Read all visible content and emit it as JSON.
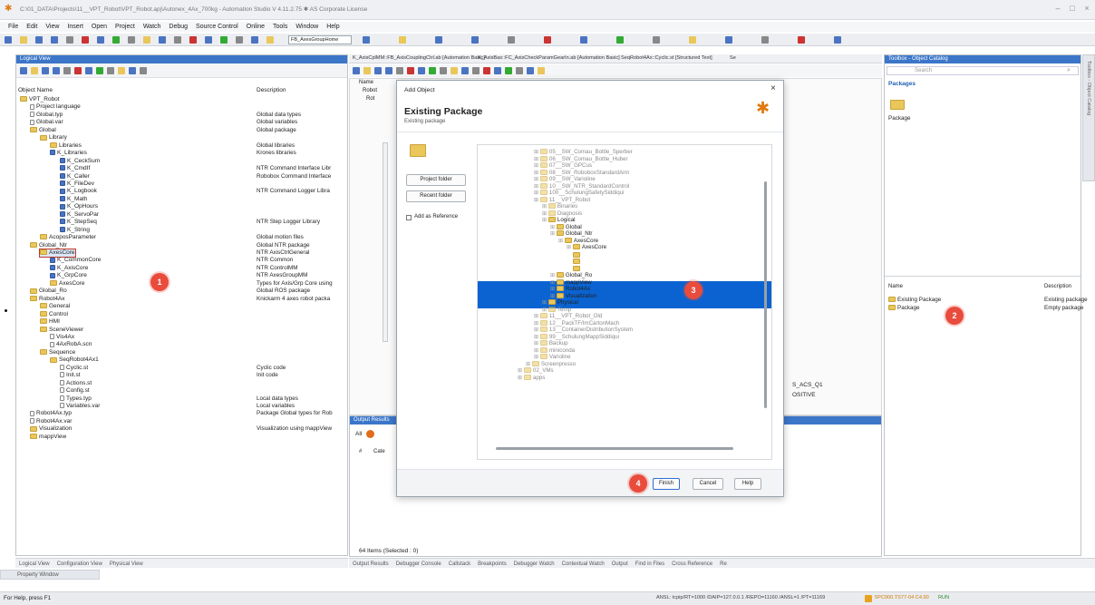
{
  "window": {
    "title": "C:\\01_DATA\\Projects\\11__VPT_Robot\\VPT_Robot.apj\\Autonex_4Ax_700kg - Automation Studio V 4.11.2.75 ✱ AS Corporate License"
  },
  "menu": [
    "File",
    "Edit",
    "View",
    "Insert",
    "Open",
    "Project",
    "Watch",
    "Debug",
    "Source Control",
    "Online",
    "Tools",
    "Window",
    "Help"
  ],
  "toolbar": {
    "combo_value": "FB_AxesGroupHome"
  },
  "logical_view": {
    "header": "Logical View",
    "col_object": "Object Name",
    "col_description": "Description",
    "items": [
      {
        "name": "VPT_Robot",
        "depth": 0,
        "desc": ""
      },
      {
        "name": "Project language",
        "depth": 1,
        "desc": ""
      },
      {
        "name": "Global.typ",
        "depth": 1,
        "desc": "Global data types"
      },
      {
        "name": "Global.var",
        "depth": 1,
        "desc": "Global variables"
      },
      {
        "name": "Global",
        "depth": 1,
        "desc": "Global package"
      },
      {
        "name": "Library",
        "depth": 2,
        "desc": ""
      },
      {
        "name": "Libraries",
        "depth": 3,
        "desc": "Global libraries"
      },
      {
        "name": "K_Libraries",
        "depth": 3,
        "desc": "Krones libraries"
      },
      {
        "name": "K_CeckSum",
        "depth": 4,
        "desc": ""
      },
      {
        "name": "K_CmdIf",
        "depth": 4,
        "desc": "NTR Command Interface Libr"
      },
      {
        "name": "K_Caller",
        "depth": 4,
        "desc": "Robobox Command Interface"
      },
      {
        "name": "K_FileDev",
        "depth": 4,
        "desc": ""
      },
      {
        "name": "K_Logbook",
        "depth": 4,
        "desc": "NTR Command Logger Libra"
      },
      {
        "name": "K_Math",
        "depth": 4,
        "desc": ""
      },
      {
        "name": "K_OpHours",
        "depth": 4,
        "desc": ""
      },
      {
        "name": "K_ServoPar",
        "depth": 4,
        "desc": ""
      },
      {
        "name": "K_StepSeq",
        "depth": 4,
        "desc": "NTR Step Logger Library"
      },
      {
        "name": "K_String",
        "depth": 4,
        "desc": ""
      },
      {
        "name": "AcoposParameter",
        "depth": 2,
        "desc": "Global motion files"
      },
      {
        "name": "Global_Ntr",
        "depth": 1,
        "desc": "Global NTR package"
      },
      {
        "name": "AxesCore",
        "depth": 2,
        "desc": "NTR AxisCtrlGeneral"
      },
      {
        "name": "K_CommonCore",
        "depth": 3,
        "desc": "NTR Common"
      },
      {
        "name": "K_AxisCore",
        "depth": 3,
        "desc": "NTR ControlMM"
      },
      {
        "name": "K_GrpCore",
        "depth": 3,
        "desc": "NTR AxesGroupMM"
      },
      {
        "name": "AxesCore",
        "depth": 3,
        "desc": "Types for Axis/Grp Core using"
      },
      {
        "name": "Global_Ro",
        "depth": 1,
        "desc": "Global ROS package"
      },
      {
        "name": "Robot4Ax",
        "depth": 1,
        "desc": "Knickarm 4 axes robot packa"
      },
      {
        "name": "General",
        "depth": 2,
        "desc": ""
      },
      {
        "name": "Control",
        "depth": 2,
        "desc": ""
      },
      {
        "name": "HMI",
        "depth": 2,
        "desc": ""
      },
      {
        "name": "SceneViewer",
        "depth": 2,
        "desc": ""
      },
      {
        "name": "Vis4Ax",
        "depth": 3,
        "desc": ""
      },
      {
        "name": "4AxRobA.scn",
        "depth": 3,
        "desc": ""
      },
      {
        "name": "Sequence",
        "depth": 2,
        "desc": ""
      },
      {
        "name": "SeqRobot4Ax1",
        "depth": 3,
        "desc": ""
      },
      {
        "name": "Cyclic.st",
        "depth": 4,
        "desc": "Cyclic code"
      },
      {
        "name": "Init.st",
        "depth": 4,
        "desc": "Init code"
      },
      {
        "name": "Actions.st",
        "depth": 4,
        "desc": ""
      },
      {
        "name": "Config.st",
        "depth": 4,
        "desc": ""
      },
      {
        "name": "Types.typ",
        "depth": 4,
        "desc": "Local data types"
      },
      {
        "name": "Variables.var",
        "depth": 4,
        "desc": "Local variables"
      },
      {
        "name": "Robot4Ax.typ",
        "depth": 1,
        "desc": "Package Global types for Rob"
      },
      {
        "name": "Robot4Ax.var",
        "depth": 1,
        "desc": ""
      },
      {
        "name": "Visualization",
        "depth": 1,
        "desc": "Visualization using mappView"
      },
      {
        "name": "mappView",
        "depth": 1,
        "desc": ""
      }
    ],
    "selected_index": 20
  },
  "editor_tabs": [
    "K_AxisCplMM::FB_AxisCouplingCtrl.ab [Automation Basic]",
    "K_AxisBas::FC_AxisCheckParamGearIn.ab [Automation Basic]",
    "SeqRobot4Ax::Cyclic.st [Structured Text]",
    "Se"
  ],
  "editor": {
    "col_name": "Name",
    "node1": "Robot",
    "node2": "Rot",
    "text1": "S_ACS_Q1",
    "text2": "OSITIVE"
  },
  "output": {
    "header": "Output Results",
    "tab_all": "All",
    "col_num": "#",
    "col_cat": "Cate",
    "status": "64 Items (Selected : 0)"
  },
  "dialog": {
    "title": "Add Object",
    "heading": "Existing Package",
    "subheading": "Existing package",
    "project_folder": "Project folder",
    "recent_folder": "Recent folder",
    "add_reference": "Add as Reference",
    "close": "×",
    "finish": "Finish",
    "cancel": "Cancel",
    "help": "Help",
    "tree": [
      {
        "name": "05__SW_Comau_Bottle_Sperber",
        "depth": 0,
        "style": "dim"
      },
      {
        "name": "06__SW_Comau_Bottle_Huber",
        "depth": 0,
        "style": "dim"
      },
      {
        "name": "07__SW_GPCus",
        "depth": 0,
        "style": "dim"
      },
      {
        "name": "08__SW_RoboboxStandardArm",
        "depth": 0,
        "style": "dim"
      },
      {
        "name": "09__SW_Varioline",
        "depth": 0,
        "style": "dim"
      },
      {
        "name": "10__SW_NTR_StandardControl",
        "depth": 0,
        "style": "dim"
      },
      {
        "name": "100__SchulungSafetySiddiqui",
        "depth": 0,
        "style": "dim"
      },
      {
        "name": "11__VPT_Robot",
        "depth": 0,
        "style": "dim"
      },
      {
        "name": "Binaries",
        "depth": 1,
        "style": "dim"
      },
      {
        "name": "Diagnosis",
        "depth": 1,
        "style": "dim"
      },
      {
        "name": "Logical",
        "depth": 1,
        "style": "dark"
      },
      {
        "name": "Global",
        "depth": 2,
        "style": "dark"
      },
      {
        "name": "Global_Ntr",
        "depth": 2,
        "style": "dark"
      },
      {
        "name": "AxesCore",
        "depth": 3,
        "style": "dark"
      },
      {
        "name": "AxesCore",
        "depth": 4,
        "style": "dark"
      },
      {
        "name": "K_AxisCore",
        "depth": 4,
        "style": "sel"
      },
      {
        "name": "K_CommonCore",
        "depth": 4,
        "style": "sel"
      },
      {
        "name": "K_GrpCore",
        "depth": 4,
        "style": "sel"
      },
      {
        "name": "Global_Ro",
        "depth": 2,
        "style": "dark"
      },
      {
        "name": "mappView",
        "depth": 2,
        "style": "dark"
      },
      {
        "name": "Robot4Ax",
        "depth": 2,
        "style": "dark"
      },
      {
        "name": "Visualization",
        "depth": 2,
        "style": "dark"
      },
      {
        "name": "Physical",
        "depth": 1,
        "style": "dark"
      },
      {
        "name": "Temp",
        "depth": 1,
        "style": "dim"
      },
      {
        "name": "11__VPT_Robot_Old",
        "depth": 0,
        "style": "dim"
      },
      {
        "name": "12__PackTF/ImCartonMach",
        "depth": 0,
        "style": "dim"
      },
      {
        "name": "13__ContainerDistributionSystem",
        "depth": 0,
        "style": "dim"
      },
      {
        "name": "99__SchulungMappSiddiqui",
        "depth": 0,
        "style": "dim"
      },
      {
        "name": "Backup",
        "depth": 0,
        "style": "dim"
      },
      {
        "name": "miniconda",
        "depth": 0,
        "style": "dim"
      },
      {
        "name": "Varioline",
        "depth": 0,
        "style": "dim"
      },
      {
        "name": "Screenpresso",
        "depth": -1,
        "style": "dim"
      },
      {
        "name": "02_VMs",
        "depth": -2,
        "style": "dim"
      },
      {
        "name": "apps",
        "depth": -2,
        "style": "dim"
      }
    ]
  },
  "toolbox": {
    "header": "Toolbox - Object Catalog",
    "search_placeholder": "Search",
    "packages_label": "Packages",
    "package_tile": "Package",
    "col_name": "Name",
    "col_desc": "Description",
    "items": [
      {
        "name": "Existing Package",
        "desc": "Existing package"
      },
      {
        "name": "Package",
        "desc": "Empty package"
      }
    ],
    "side_tab": "Toolbox - Object Catalog"
  },
  "bottom_tabs_left": [
    "Logical View",
    "Configuration View",
    "Physical View"
  ],
  "bottom_tabs_center": [
    "Output Results",
    "Debugger Console",
    "Callstack",
    "Breakpoints",
    "Debugger Watch",
    "Contextual Watch",
    "Output",
    "Find in Files",
    "Cross Reference",
    "Re"
  ],
  "property_window": "Property Window",
  "status": {
    "left": "For Help, press F1",
    "right": "ANSL: tcpip/RT=1000 /DAIP=127.0.0.1 /REPO=11160 /ANSL=1 /PT=11169",
    "cpu": "5PC900.TS77-04 C4.90",
    "mode": "RUN"
  },
  "markers": [
    "1",
    "2",
    "3",
    "4"
  ],
  "colors": {
    "accent": "#3b76c9",
    "selection": "#0a63d1",
    "marker": "#e94b3c"
  }
}
